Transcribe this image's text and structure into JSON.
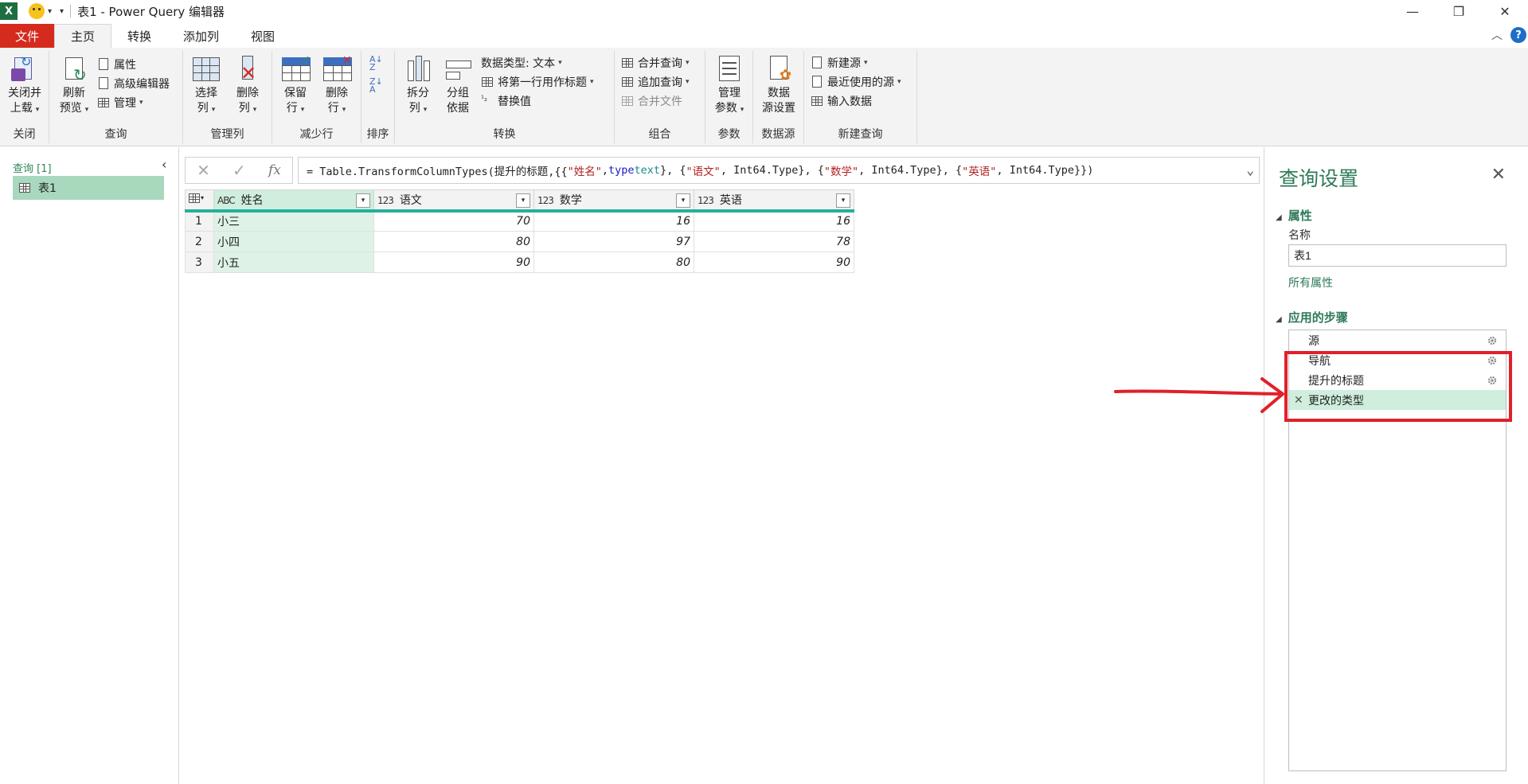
{
  "titlebar": {
    "app_badge": "X",
    "title": "表1 - Power Query 编辑器",
    "minimize": "—",
    "restore": "❐",
    "close": "✕"
  },
  "menu": {
    "file": "文件",
    "tabs": [
      "主页",
      "转换",
      "添加列",
      "视图"
    ],
    "active_tab": "主页",
    "help": "?"
  },
  "ribbon": {
    "close_group": {
      "label": "关闭",
      "close_load": [
        "关闭并",
        "上载"
      ]
    },
    "query_group": {
      "label": "查询",
      "refresh": [
        "刷新",
        "预览"
      ],
      "properties": "属性",
      "advanced_editor": "高级编辑器",
      "manage": "管理"
    },
    "manage_cols_group": {
      "label": "管理列",
      "choose": [
        "选择",
        "列"
      ],
      "remove": [
        "删除",
        "列"
      ]
    },
    "reduce_rows_group": {
      "label": "减少行",
      "keep": [
        "保留",
        "行"
      ],
      "remove": [
        "删除",
        "行"
      ]
    },
    "sort_group": {
      "label": "排序"
    },
    "transform_group": {
      "label": "转换",
      "split": [
        "拆分",
        "列"
      ],
      "group_by": [
        "分组",
        "依据"
      ],
      "data_type": "数据类型: 文本",
      "first_row_header": "将第一行用作标题",
      "replace_values": "替换值"
    },
    "combine_group": {
      "label": "组合",
      "merge": "合并查询",
      "append": "追加查询",
      "combine_files": "合并文件"
    },
    "params_group": {
      "label": "参数",
      "manage_params": [
        "管理",
        "参数"
      ]
    },
    "datasource_group": {
      "label": "数据源",
      "settings": [
        "数据",
        "源设置"
      ]
    },
    "newquery_group": {
      "label": "新建查询",
      "new_source": "新建源",
      "recent_sources": "最近使用的源",
      "enter_data": "输入数据"
    }
  },
  "left_pane": {
    "header": "查询 [1]",
    "items": [
      "表1"
    ]
  },
  "formula_bar": {
    "cancel": "✕",
    "confirm": "✓",
    "fx": "fx",
    "p1": "= Table.TransformColumnTypes(提升的标题,{{",
    "s1": "\"姓名\"",
    "p2": ", ",
    "k1": "type",
    "p3": " ",
    "t1": "text",
    "p4": "}, {",
    "s2": "\"语文\"",
    "p5": ", Int64.Type}, {",
    "s3": "\"数学\"",
    "p6": ", Int64.Type}, {",
    "s4": "\"英语\"",
    "p7": ", Int64.Type}})"
  },
  "grid": {
    "columns": [
      {
        "type_icon": "ABC",
        "name": "姓名"
      },
      {
        "type_icon": "123",
        "name": "语文"
      },
      {
        "type_icon": "123",
        "name": "数学"
      },
      {
        "type_icon": "123",
        "name": "英语"
      }
    ],
    "rows": [
      {
        "n": "1",
        "name": "小三",
        "v1": "70",
        "v2": "16",
        "v3": "16"
      },
      {
        "n": "2",
        "name": "小四",
        "v1": "80",
        "v2": "97",
        "v3": "78"
      },
      {
        "n": "3",
        "name": "小五",
        "v1": "90",
        "v2": "80",
        "v3": "90"
      }
    ]
  },
  "right_pane": {
    "title": "查询设置",
    "close": "✕",
    "properties_header": "属性",
    "name_label": "名称",
    "name_value": "表1",
    "all_properties": "所有属性",
    "steps_header": "应用的步骤",
    "steps": [
      "源",
      "导航",
      "提升的标题",
      "更改的类型"
    ],
    "active_step": "更改的类型"
  },
  "colors": {
    "accent": "#2e7a58",
    "file_tab": "#d52b1e",
    "highlight": "#e0202a",
    "header_bar": "#26b09b"
  }
}
